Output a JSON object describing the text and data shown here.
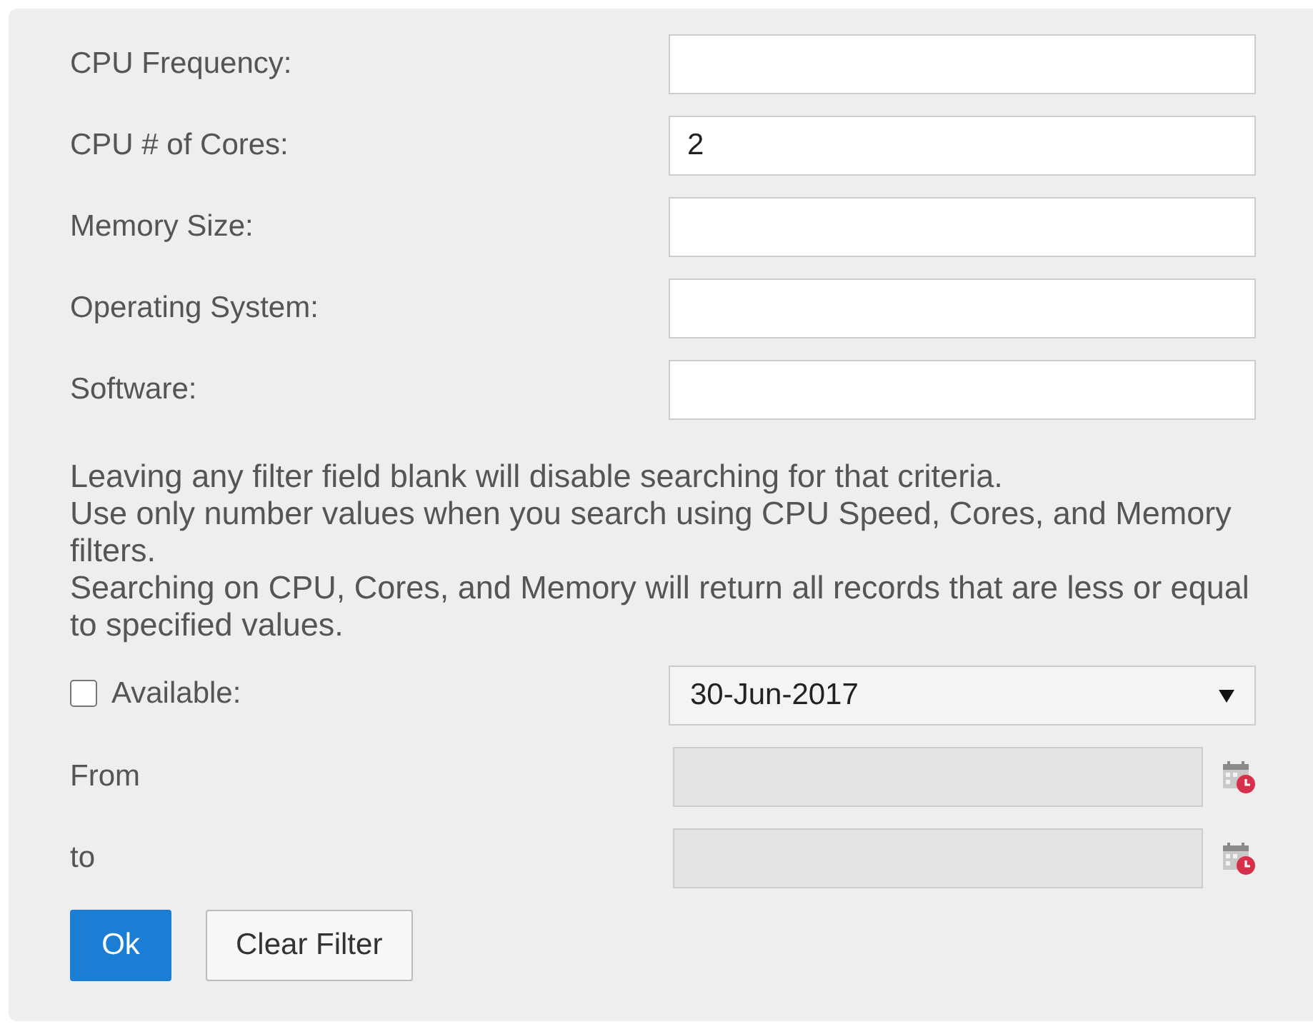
{
  "fields": [
    {
      "label": "CPU Frequency:"
    },
    {
      "label": "CPU # of Cores:",
      "value": "2"
    },
    {
      "label": "Memory Size:"
    },
    {
      "label": "Operating System:"
    },
    {
      "label": "Software:"
    }
  ],
  "notes": [
    "Leaving any filter field blank will disable searching for that criteria.",
    "Use only number values when you search using CPU Speed, Cores, and Memory filters.",
    "Searching on CPU, Cores, and Memory will return all records that are less or equal to specified values."
  ],
  "available": {
    "label": "Available:",
    "checked": false,
    "dropdown_value": "30-Jun-2017"
  },
  "date_fields": [
    {
      "label": "From",
      "disabled": true
    },
    {
      "label": "to",
      "disabled": true
    }
  ],
  "buttons": [
    {
      "label": "Ok",
      "kind": "primary"
    },
    {
      "label": "Clear Filter",
      "kind": "secondary"
    }
  ]
}
